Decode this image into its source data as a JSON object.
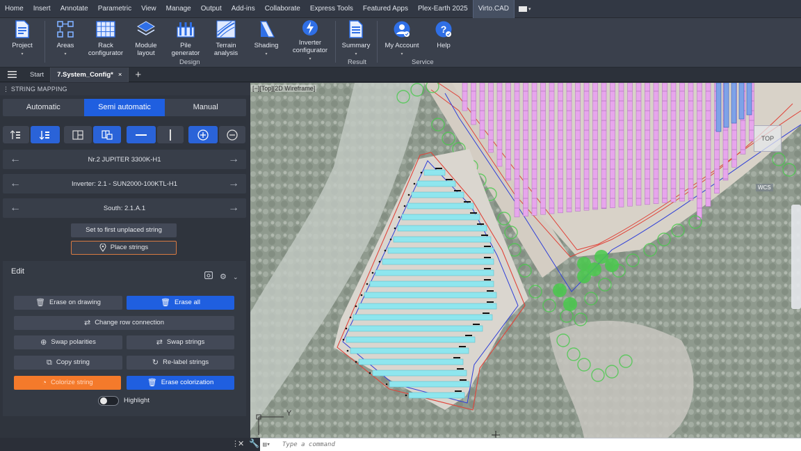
{
  "menu": {
    "items": [
      "Home",
      "Insert",
      "Annotate",
      "Parametric",
      "View",
      "Manage",
      "Output",
      "Add-ins",
      "Collaborate",
      "Express Tools",
      "Featured Apps",
      "Plex-Earth 2025",
      "Virto.CAD"
    ],
    "active_index": 12
  },
  "ribbon": {
    "buttons": [
      {
        "label": "Project",
        "icon": "document-icon",
        "has_arrow": true
      },
      {
        "label": "Areas",
        "icon": "areas-icon",
        "has_arrow": true
      },
      {
        "label": "Rack configurator",
        "icon": "rack-grid-icon",
        "has_arrow": false
      },
      {
        "label": "Module layout",
        "icon": "layers-icon",
        "has_arrow": true
      },
      {
        "label": "Pile generator",
        "icon": "pile-icon",
        "has_arrow": false
      },
      {
        "label": "Terrain analysis",
        "icon": "terrain-icon",
        "has_arrow": false
      },
      {
        "label": "Shading",
        "icon": "shading-icon",
        "has_arrow": true
      },
      {
        "label": "Inverter configurator",
        "icon": "inverter-icon",
        "has_arrow": true
      },
      {
        "label": "Summary",
        "icon": "summary-document-icon",
        "has_arrow": true
      },
      {
        "label": "My Account",
        "icon": "account-icon",
        "has_arrow": true
      },
      {
        "label": "Help",
        "icon": "help-icon",
        "has_arrow": false
      }
    ],
    "groups": [
      "Design",
      "Result",
      "Service"
    ]
  },
  "tabs": {
    "start": "Start",
    "current": "7.System_Config*",
    "close": "×",
    "plus": "+"
  },
  "panel": {
    "title": "STRING MAPPING",
    "modes": [
      "Automatic",
      "Semi automatic",
      "Manual"
    ],
    "active_mode": 1,
    "nav": {
      "inverter_model": "Nr.2 JUPITER 3300K-H1",
      "inverter": "Inverter: 2.1 - SUN2000-100KTL-H1",
      "area": "South: 2.1.A.1"
    },
    "set_first": "Set to first unplaced string",
    "place_strings": "Place strings",
    "edit": {
      "title": "Edit",
      "erase_on_drawing": "Erase on drawing",
      "erase_all": "Erase all",
      "change_row_connection": "Change row connection",
      "swap_polarities": "Swap polarities",
      "swap_strings": "Swap strings",
      "copy_string": "Copy string",
      "relabel_strings": "Re-label strings",
      "colorize_string": "Colorize string",
      "erase_colorization": "Erase colorization",
      "highlight": "Highlight"
    }
  },
  "viewport": {
    "label": "[−][Top][2D Wireframe]",
    "viewcube": "TOP",
    "wcs": "WCS",
    "axis_y": "Y"
  },
  "command": {
    "placeholder": "Type a command"
  },
  "colors": {
    "accent_blue": "#1f5fe0",
    "orange": "#f47a2b",
    "panel_bg": "#2f343d",
    "module_cyan": "#8fe6ee",
    "module_pink": "#e7a6ec",
    "boundary_red": "#e0443a",
    "path_blue": "#2f3fd8",
    "tree_green": "#49c94c"
  }
}
